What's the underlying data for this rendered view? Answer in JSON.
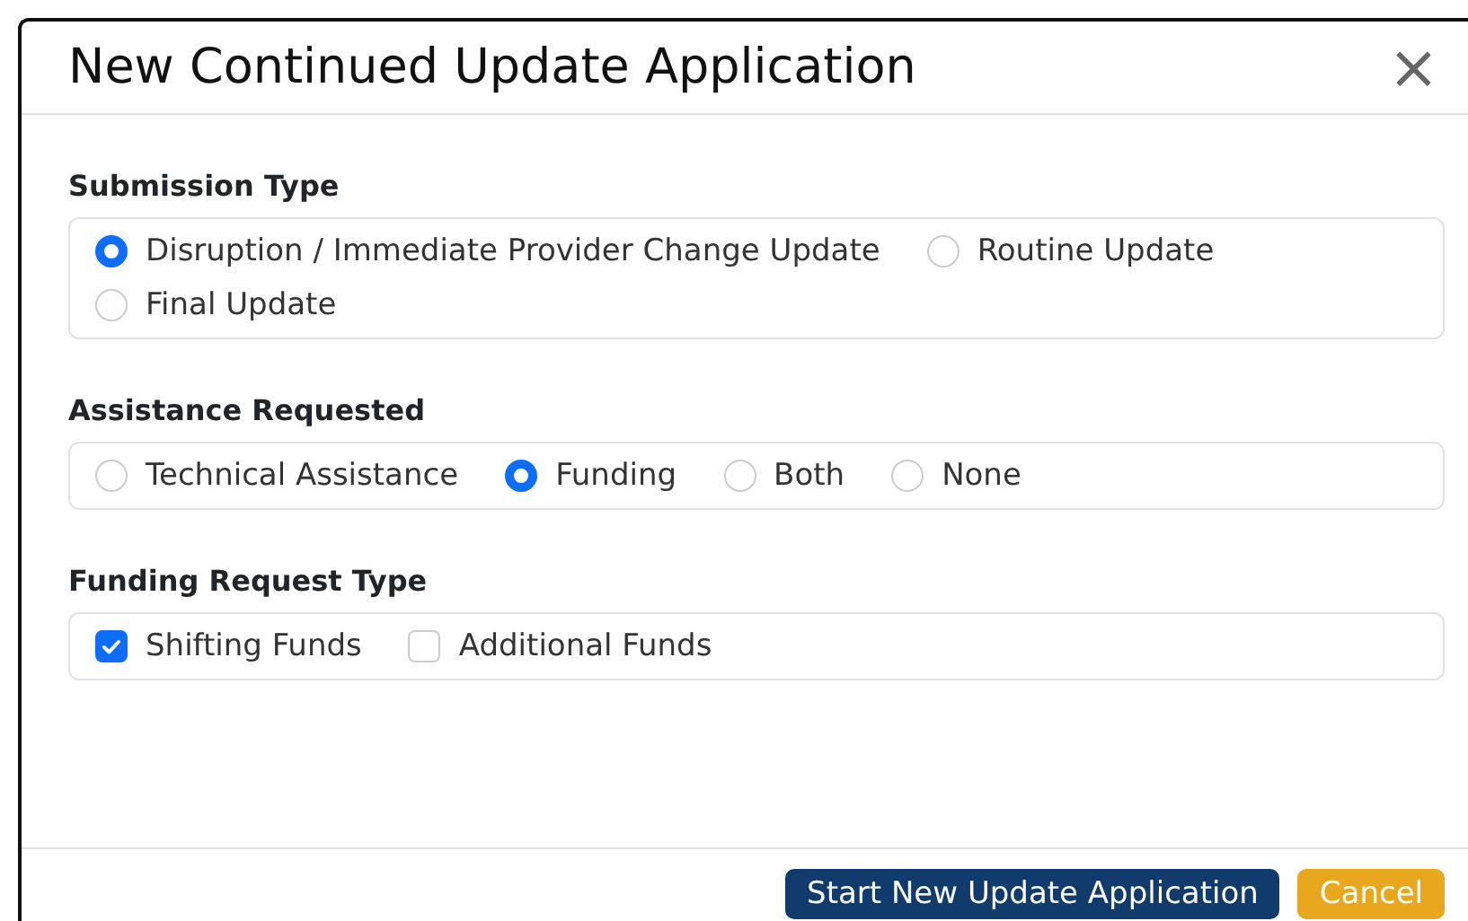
{
  "dialog": {
    "title": "New Continued Update Application",
    "close": "×"
  },
  "groups": [
    {
      "label": "Submission Type",
      "kind": "radio",
      "options": [
        {
          "label": "Disruption / Immediate Provider Change Update",
          "selected": true
        },
        {
          "label": "Routine Update",
          "selected": false
        },
        {
          "label": "Final Update",
          "selected": false
        }
      ]
    },
    {
      "label": "Assistance Requested",
      "kind": "radio",
      "options": [
        {
          "label": "Technical Assistance",
          "selected": false
        },
        {
          "label": "Funding",
          "selected": true
        },
        {
          "label": "Both",
          "selected": false
        },
        {
          "label": "None",
          "selected": false
        }
      ]
    },
    {
      "label": "Funding Request Type",
      "kind": "checkbox",
      "options": [
        {
          "label": "Shifting Funds",
          "checked": true
        },
        {
          "label": "Additional Funds",
          "checked": false
        }
      ]
    }
  ],
  "buttons": [
    {
      "label": "Start New Update Application",
      "kind": "primary"
    },
    {
      "label": "Cancel",
      "kind": "warning"
    }
  ]
}
